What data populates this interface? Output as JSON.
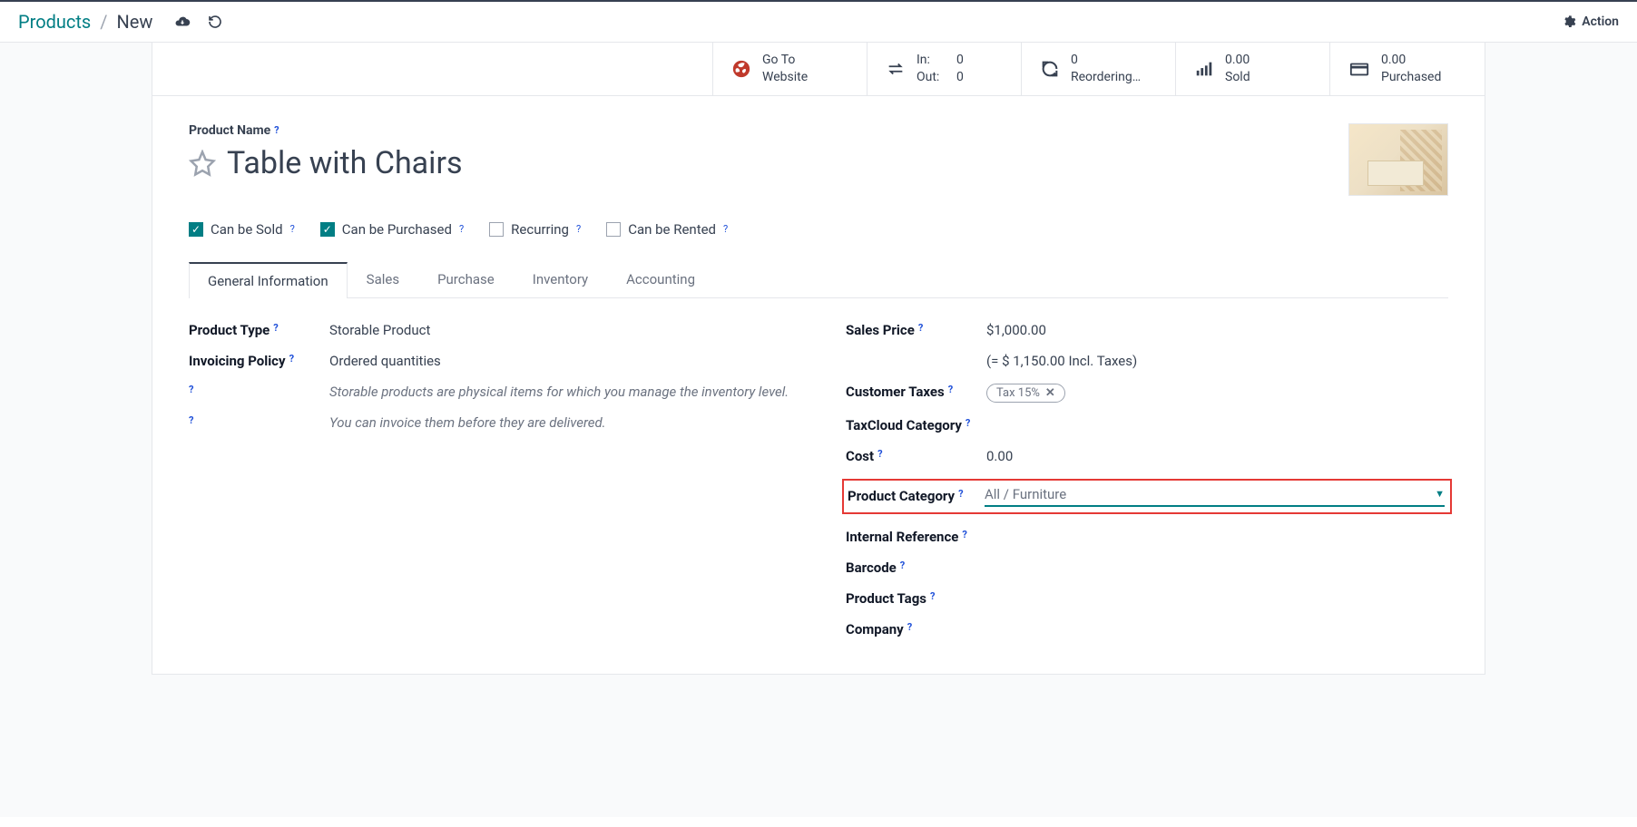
{
  "breadcrumb": {
    "root": "Products",
    "current": "New"
  },
  "action_label": "Action",
  "stats": {
    "website": {
      "l1": "Go To",
      "l2": "Website"
    },
    "inout": {
      "in_label": "In:",
      "in_val": "0",
      "out_label": "Out:",
      "out_val": "0"
    },
    "reorder": {
      "val": "0",
      "label": "Reordering…"
    },
    "sold": {
      "val": "0.00",
      "label": "Sold"
    },
    "purchased": {
      "val": "0.00",
      "label": "Purchased"
    }
  },
  "product": {
    "name_label": "Product Name",
    "name": "Table with Chairs"
  },
  "checks": {
    "sold": {
      "label": "Can be Sold",
      "checked": true
    },
    "purchased": {
      "label": "Can be Purchased",
      "checked": true
    },
    "recurring": {
      "label": "Recurring",
      "checked": false
    },
    "rented": {
      "label": "Can be Rented",
      "checked": false
    }
  },
  "tabs": {
    "general": "General Information",
    "sales": "Sales",
    "purchase": "Purchase",
    "inventory": "Inventory",
    "accounting": "Accounting"
  },
  "left": {
    "product_type_label": "Product Type",
    "product_type": "Storable Product",
    "invoicing_label": "Invoicing Policy",
    "invoicing": "Ordered quantities",
    "note1": "Storable products are physical items for which you manage the inventory level.",
    "note2": "You can invoice them before they are delivered."
  },
  "right": {
    "sales_price_label": "Sales Price",
    "sales_price": "$1,000.00",
    "sales_price_inc": "(= $ 1,150.00 Incl. Taxes)",
    "cust_tax_label": "Customer Taxes",
    "cust_tax_value": "Tax 15%",
    "taxcloud_label": "TaxCloud Category",
    "cost_label": "Cost",
    "cost": "0.00",
    "category_label": "Product Category",
    "category": "All / Furniture",
    "internal_ref_label": "Internal Reference",
    "barcode_label": "Barcode",
    "tags_label": "Product Tags",
    "company_label": "Company"
  }
}
